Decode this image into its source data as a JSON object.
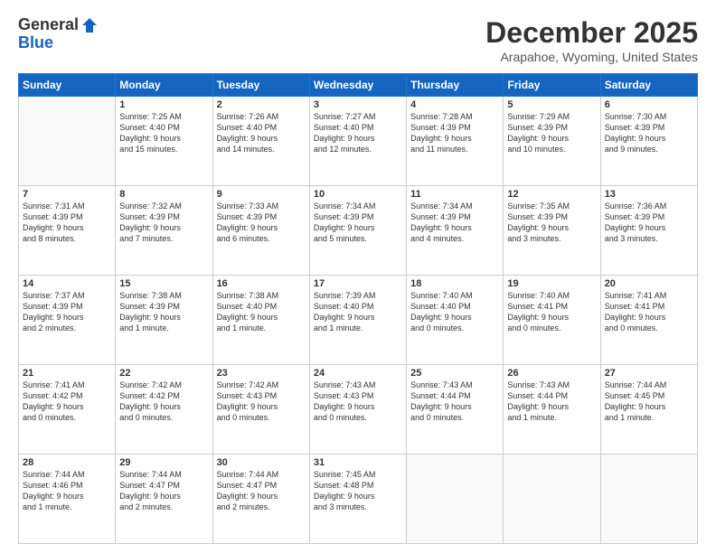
{
  "header": {
    "logo_general": "General",
    "logo_blue": "Blue",
    "month_title": "December 2025",
    "location": "Arapahoe, Wyoming, United States"
  },
  "weekdays": [
    "Sunday",
    "Monday",
    "Tuesday",
    "Wednesday",
    "Thursday",
    "Friday",
    "Saturday"
  ],
  "weeks": [
    [
      {
        "day": "",
        "info": ""
      },
      {
        "day": "1",
        "info": "Sunrise: 7:25 AM\nSunset: 4:40 PM\nDaylight: 9 hours\nand 15 minutes."
      },
      {
        "day": "2",
        "info": "Sunrise: 7:26 AM\nSunset: 4:40 PM\nDaylight: 9 hours\nand 14 minutes."
      },
      {
        "day": "3",
        "info": "Sunrise: 7:27 AM\nSunset: 4:40 PM\nDaylight: 9 hours\nand 12 minutes."
      },
      {
        "day": "4",
        "info": "Sunrise: 7:28 AM\nSunset: 4:39 PM\nDaylight: 9 hours\nand 11 minutes."
      },
      {
        "day": "5",
        "info": "Sunrise: 7:29 AM\nSunset: 4:39 PM\nDaylight: 9 hours\nand 10 minutes."
      },
      {
        "day": "6",
        "info": "Sunrise: 7:30 AM\nSunset: 4:39 PM\nDaylight: 9 hours\nand 9 minutes."
      }
    ],
    [
      {
        "day": "7",
        "info": "Sunrise: 7:31 AM\nSunset: 4:39 PM\nDaylight: 9 hours\nand 8 minutes."
      },
      {
        "day": "8",
        "info": "Sunrise: 7:32 AM\nSunset: 4:39 PM\nDaylight: 9 hours\nand 7 minutes."
      },
      {
        "day": "9",
        "info": "Sunrise: 7:33 AM\nSunset: 4:39 PM\nDaylight: 9 hours\nand 6 minutes."
      },
      {
        "day": "10",
        "info": "Sunrise: 7:34 AM\nSunset: 4:39 PM\nDaylight: 9 hours\nand 5 minutes."
      },
      {
        "day": "11",
        "info": "Sunrise: 7:34 AM\nSunset: 4:39 PM\nDaylight: 9 hours\nand 4 minutes."
      },
      {
        "day": "12",
        "info": "Sunrise: 7:35 AM\nSunset: 4:39 PM\nDaylight: 9 hours\nand 3 minutes."
      },
      {
        "day": "13",
        "info": "Sunrise: 7:36 AM\nSunset: 4:39 PM\nDaylight: 9 hours\nand 3 minutes."
      }
    ],
    [
      {
        "day": "14",
        "info": "Sunrise: 7:37 AM\nSunset: 4:39 PM\nDaylight: 9 hours\nand 2 minutes."
      },
      {
        "day": "15",
        "info": "Sunrise: 7:38 AM\nSunset: 4:39 PM\nDaylight: 9 hours\nand 1 minute."
      },
      {
        "day": "16",
        "info": "Sunrise: 7:38 AM\nSunset: 4:40 PM\nDaylight: 9 hours\nand 1 minute."
      },
      {
        "day": "17",
        "info": "Sunrise: 7:39 AM\nSunset: 4:40 PM\nDaylight: 9 hours\nand 1 minute."
      },
      {
        "day": "18",
        "info": "Sunrise: 7:40 AM\nSunset: 4:40 PM\nDaylight: 9 hours\nand 0 minutes."
      },
      {
        "day": "19",
        "info": "Sunrise: 7:40 AM\nSunset: 4:41 PM\nDaylight: 9 hours\nand 0 minutes."
      },
      {
        "day": "20",
        "info": "Sunrise: 7:41 AM\nSunset: 4:41 PM\nDaylight: 9 hours\nand 0 minutes."
      }
    ],
    [
      {
        "day": "21",
        "info": "Sunrise: 7:41 AM\nSunset: 4:42 PM\nDaylight: 9 hours\nand 0 minutes."
      },
      {
        "day": "22",
        "info": "Sunrise: 7:42 AM\nSunset: 4:42 PM\nDaylight: 9 hours\nand 0 minutes."
      },
      {
        "day": "23",
        "info": "Sunrise: 7:42 AM\nSunset: 4:43 PM\nDaylight: 9 hours\nand 0 minutes."
      },
      {
        "day": "24",
        "info": "Sunrise: 7:43 AM\nSunset: 4:43 PM\nDaylight: 9 hours\nand 0 minutes."
      },
      {
        "day": "25",
        "info": "Sunrise: 7:43 AM\nSunset: 4:44 PM\nDaylight: 9 hours\nand 0 minutes."
      },
      {
        "day": "26",
        "info": "Sunrise: 7:43 AM\nSunset: 4:44 PM\nDaylight: 9 hours\nand 1 minute."
      },
      {
        "day": "27",
        "info": "Sunrise: 7:44 AM\nSunset: 4:45 PM\nDaylight: 9 hours\nand 1 minute."
      }
    ],
    [
      {
        "day": "28",
        "info": "Sunrise: 7:44 AM\nSunset: 4:46 PM\nDaylight: 9 hours\nand 1 minute."
      },
      {
        "day": "29",
        "info": "Sunrise: 7:44 AM\nSunset: 4:47 PM\nDaylight: 9 hours\nand 2 minutes."
      },
      {
        "day": "30",
        "info": "Sunrise: 7:44 AM\nSunset: 4:47 PM\nDaylight: 9 hours\nand 2 minutes."
      },
      {
        "day": "31",
        "info": "Sunrise: 7:45 AM\nSunset: 4:48 PM\nDaylight: 9 hours\nand 3 minutes."
      },
      {
        "day": "",
        "info": ""
      },
      {
        "day": "",
        "info": ""
      },
      {
        "day": "",
        "info": ""
      }
    ]
  ]
}
